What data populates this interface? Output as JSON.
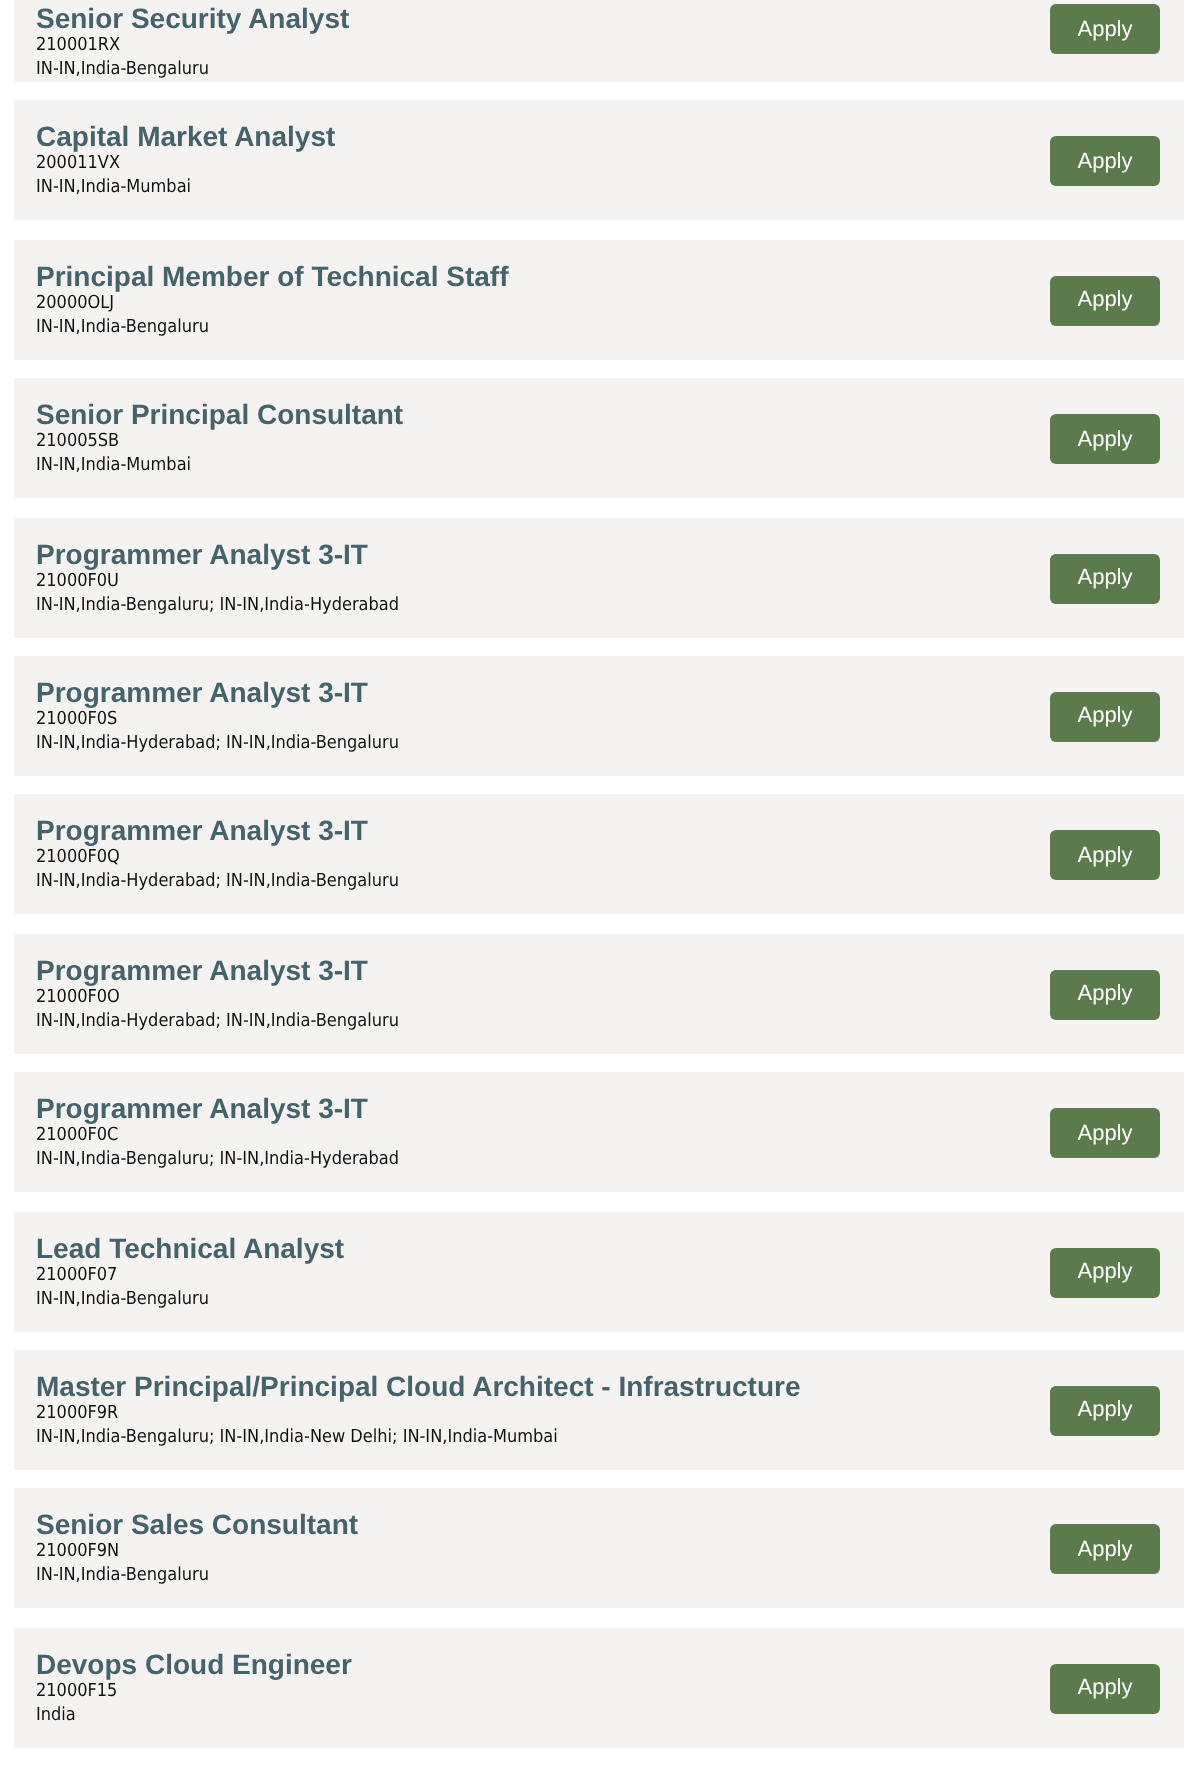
{
  "jobs": [
    {
      "title": "Senior Security Analyst",
      "id": "210001RX",
      "location": "IN-IN,India-Bengaluru",
      "button": "Apply"
    },
    {
      "title": "Capital Market Analyst",
      "id": "200011VX",
      "location": "IN-IN,India-Mumbai",
      "button": "Apply"
    },
    {
      "title": "Principal Member of Technical Staff",
      "id": "20000OLJ",
      "location": "IN-IN,India-Bengaluru",
      "button": "Apply"
    },
    {
      "title": "Senior Principal Consultant",
      "id": "210005SB",
      "location": "IN-IN,India-Mumbai",
      "button": "Apply"
    },
    {
      "title": "Programmer Analyst 3-IT",
      "id": "21000F0U",
      "location": "IN-IN,India-Bengaluru; IN-IN,India-Hyderabad",
      "button": "Apply"
    },
    {
      "title": "Programmer Analyst 3-IT",
      "id": "21000F0S",
      "location": "IN-IN,India-Hyderabad; IN-IN,India-Bengaluru",
      "button": "Apply"
    },
    {
      "title": "Programmer Analyst 3-IT",
      "id": "21000F0Q",
      "location": "IN-IN,India-Hyderabad; IN-IN,India-Bengaluru",
      "button": "Apply"
    },
    {
      "title": "Programmer Analyst 3-IT",
      "id": "21000F0O",
      "location": "IN-IN,India-Hyderabad; IN-IN,India-Bengaluru",
      "button": "Apply"
    },
    {
      "title": "Programmer Analyst 3-IT",
      "id": "21000F0C",
      "location": "IN-IN,India-Bengaluru; IN-IN,India-Hyderabad",
      "button": "Apply"
    },
    {
      "title": "Lead Technical Analyst",
      "id": "21000F07",
      "location": "IN-IN,India-Bengaluru",
      "button": "Apply"
    },
    {
      "title": "Master Principal/Principal Cloud Architect - Infrastructure",
      "id": "21000F9R",
      "location": "IN-IN,India-Bengaluru; IN-IN,India-New Delhi; IN-IN,India-Mumbai",
      "button": "Apply"
    },
    {
      "title": "Senior Sales Consultant",
      "id": "21000F9N",
      "location": "IN-IN,India-Bengaluru",
      "button": "Apply"
    },
    {
      "title": "Devops Cloud Engineer",
      "id": "21000F15",
      "location": "India",
      "button": "Apply"
    }
  ]
}
